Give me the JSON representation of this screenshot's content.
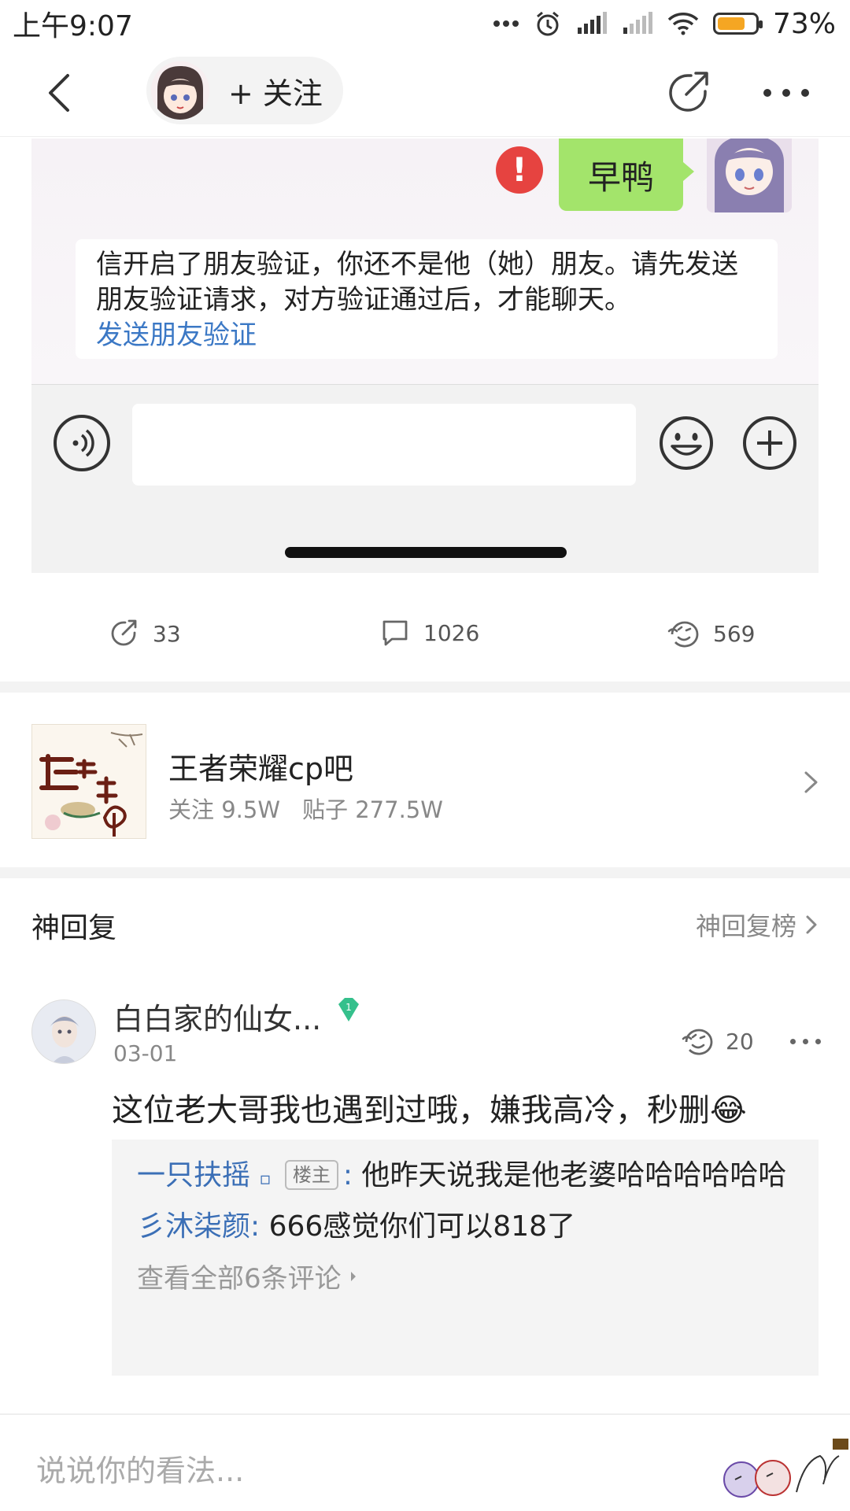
{
  "status_bar": {
    "time": "上午9:07",
    "battery": "73%",
    "battery_level": 0.73
  },
  "nav": {
    "follow_label": "+ 关注"
  },
  "post_image": {
    "bubble_text": "早鸭",
    "error_mark": "!",
    "system_message": "信开启了朋友验证，你还不是他（她）朋友。请先发送朋友验证请求，对方验证通过后，才能聊天。",
    "system_link": "发送朋友验证"
  },
  "actions": {
    "share_count": "33",
    "comment_count": "1026",
    "like_count": "569"
  },
  "forum": {
    "name": "王者荣耀cp吧",
    "followers": "关注 9.5W",
    "posts": "贴子 277.5W"
  },
  "hot_replies": {
    "title": "神回复",
    "rank_link": "神回复榜"
  },
  "comment": {
    "username": "白白家的仙女...",
    "level": "1",
    "date": "03-01",
    "likes": "20",
    "text": "这位老大哥我也遇到过哦，嫌我高冷，秒删😂",
    "replies": [
      {
        "user": "一只扶摇",
        "mark": "▫",
        "tag": "楼主",
        "text": "他昨天说我是他老婆哈哈哈哈哈哈"
      },
      {
        "user": "彡沐柒颜",
        "text": "666感觉你们可以818了"
      }
    ],
    "view_all": "查看全部6条评论"
  },
  "bottom": {
    "placeholder": "说说你的看法..."
  }
}
